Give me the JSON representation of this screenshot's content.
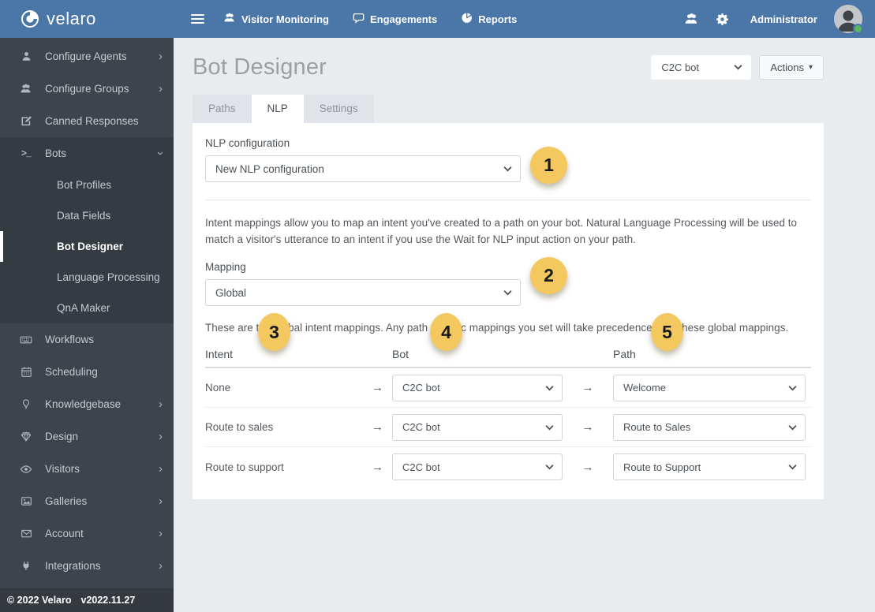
{
  "theme": {
    "topbar_blue": "#4b76a8",
    "sidebar_dark": "#3d444b",
    "badge_yellow": "#f3c85e",
    "status_online_green": "#5cb85c"
  },
  "topbar": {
    "brand": "velaro",
    "nav": [
      {
        "label": "Visitor Monitoring"
      },
      {
        "label": "Engagements"
      },
      {
        "label": "Reports"
      }
    ],
    "username": "Administrator"
  },
  "sidebar": {
    "items": [
      {
        "label": "Configure Agents"
      },
      {
        "label": "Configure Groups"
      },
      {
        "label": "Canned Responses"
      },
      {
        "label": "Bots"
      },
      {
        "label": "Bot Profiles"
      },
      {
        "label": "Data Fields"
      },
      {
        "label": "Bot Designer"
      },
      {
        "label": "Language Processing"
      },
      {
        "label": "QnA Maker"
      },
      {
        "label": "Workflows"
      },
      {
        "label": "Scheduling"
      },
      {
        "label": "Knowledgebase"
      },
      {
        "label": "Design"
      },
      {
        "label": "Visitors"
      },
      {
        "label": "Galleries"
      },
      {
        "label": "Account"
      },
      {
        "label": "Integrations"
      }
    ],
    "footer": {
      "copyright": "© 2022 Velaro",
      "version": "v2022.11.27"
    }
  },
  "main": {
    "title": "Bot Designer",
    "bot_selector_value": "C2C bot",
    "actions_label": "Actions",
    "tabs": [
      {
        "label": "Paths"
      },
      {
        "label": "NLP"
      },
      {
        "label": "Settings"
      }
    ],
    "badges": [
      "1",
      "2",
      "3",
      "4",
      "5"
    ],
    "nlp": {
      "config_label": "NLP configuration",
      "config_value": "New NLP configuration",
      "intro": "Intent mappings allow you to map an intent you've created to a path on your bot. Natural Language Processing will be used to match a visitor's utterance to an intent if you use the Wait for NLP input action on your path.",
      "mapping_label": "Mapping",
      "mapping_value": "Global",
      "note": "These are the global intent mappings. Any path specific mappings you set will take precedence over these global mappings.",
      "arrow": "→",
      "table": {
        "headers": [
          "Intent",
          "Bot",
          "Path"
        ],
        "rows": [
          {
            "intent": "None",
            "bot": "C2C bot",
            "path": "Welcome"
          },
          {
            "intent": "Route to sales",
            "bot": "C2C bot",
            "path": "Route to Sales"
          },
          {
            "intent": "Route to support",
            "bot": "C2C bot",
            "path": "Route to Support"
          }
        ]
      }
    }
  }
}
